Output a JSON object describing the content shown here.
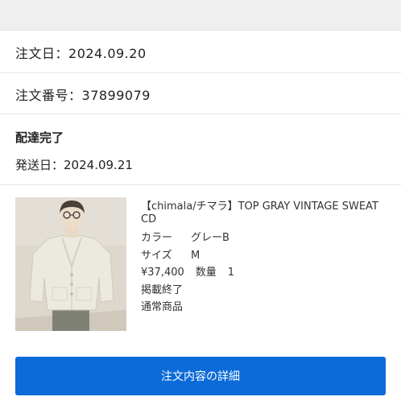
{
  "order": {
    "date_label": "注文日：",
    "date_value": "2024.09.20",
    "number_label": "注文番号：",
    "number_value": "37899079"
  },
  "delivery": {
    "status": "配達完了",
    "ship_label": "発送日：",
    "ship_date": "2024.09.21"
  },
  "product": {
    "title": "【chimala/チマラ】TOP GRAY VINTAGE SWEAT CD",
    "color_label": "カラー",
    "color_value": "グレーB",
    "size_label": "サイズ",
    "size_value": "M",
    "price": "¥37,400",
    "quantity_label": "数量",
    "quantity_value": "1",
    "listing_status": "掲載終了",
    "product_type": "通常商品"
  },
  "actions": {
    "detail_button_label": "注文内容の詳細"
  },
  "colors": {
    "accent": "#0b6bd8",
    "header_bg": "#efefef"
  }
}
